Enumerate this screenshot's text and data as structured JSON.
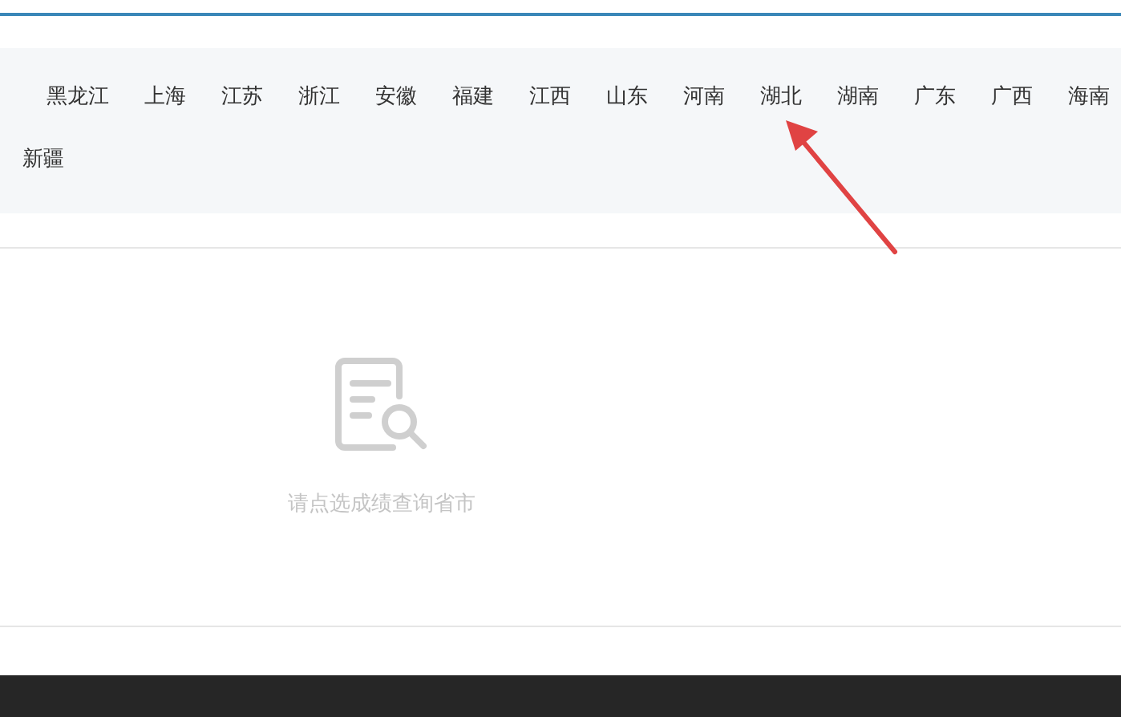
{
  "provinces": [
    {
      "label": "黑龙江",
      "selected": false
    },
    {
      "label": "上海",
      "selected": false
    },
    {
      "label": "江苏",
      "selected": false
    },
    {
      "label": "浙江",
      "selected": false
    },
    {
      "label": "安徽",
      "selected": false
    },
    {
      "label": "福建",
      "selected": false
    },
    {
      "label": "江西",
      "selected": false
    },
    {
      "label": "山东",
      "selected": false
    },
    {
      "label": "河南",
      "selected": false
    },
    {
      "label": "湖北",
      "selected": false
    },
    {
      "label": "湖南",
      "selected": false
    },
    {
      "label": "广东",
      "selected": false
    },
    {
      "label": "广西",
      "selected": false
    },
    {
      "label": "海南",
      "selected": false
    }
  ],
  "provinces_row_2": [
    {
      "label": "新疆",
      "selected": false
    }
  ],
  "empty_state": {
    "message": "请点选成绩查询省市"
  }
}
